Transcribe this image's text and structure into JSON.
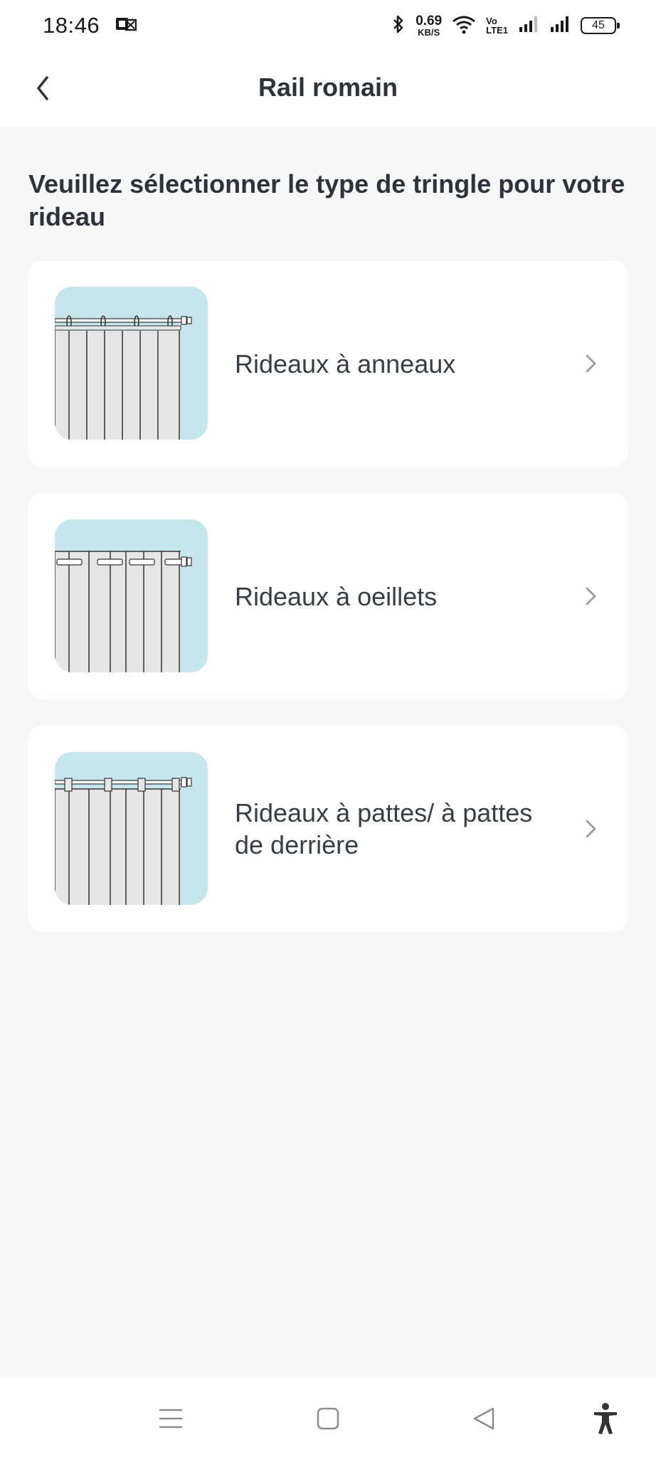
{
  "status_bar": {
    "time": "18:46",
    "net_speed_value": "0.69",
    "net_speed_unit": "KB/S",
    "volte_top": "Vo",
    "volte_bottom": "LTE1",
    "battery": "45",
    "icons": [
      "notification-icon",
      "bluetooth-icon",
      "wifi-icon",
      "volte-icon",
      "signal-icon",
      "signal-icon",
      "battery-icon"
    ]
  },
  "header": {
    "title": "Rail romain",
    "back_icon": "chevron-left-icon"
  },
  "prompt": "Veuillez sélectionner le type de tringle pour votre rideau",
  "options": [
    {
      "label": "Rideaux à anneaux",
      "image": "curtain-rings-illustration"
    },
    {
      "label": "Rideaux à oeillets",
      "image": "curtain-eyelets-illustration"
    },
    {
      "label": "Rideaux à pattes/ à pattes de derrière",
      "image": "curtain-tabs-illustration"
    }
  ],
  "nav_bar": {
    "icons": [
      "menu-icon",
      "home-square-icon",
      "back-triangle-icon",
      "accessibility-icon"
    ]
  },
  "colors": {
    "background": "#f7f7f7",
    "card": "#ffffff",
    "thumb_bg": "#c5e7ec",
    "curtain": "#e6e6e6",
    "text": "#2f323a"
  }
}
